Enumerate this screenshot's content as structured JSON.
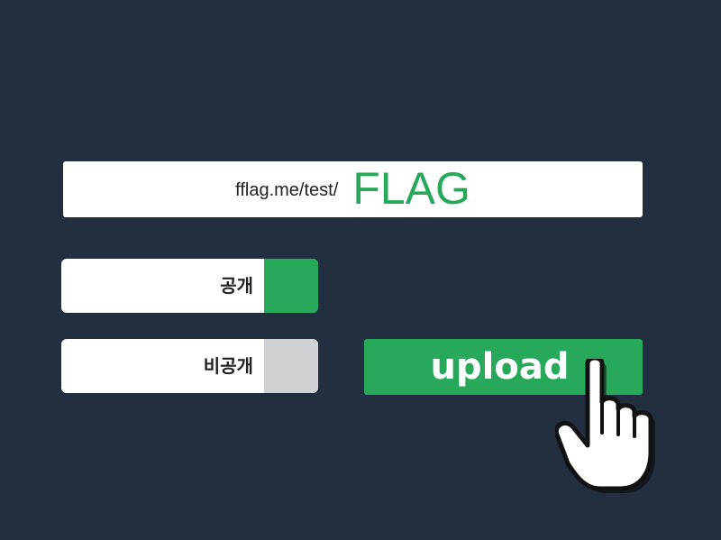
{
  "url_field": {
    "prefix": "fflag.me/test/",
    "slug": "FLAG"
  },
  "visibility": {
    "public_label": "공개",
    "private_label": "비공개",
    "selected": "public"
  },
  "upload_button": {
    "label": "upload"
  },
  "cursor": {
    "icon": "hand-pointer-icon"
  },
  "colors": {
    "background": "#222f40",
    "accent": "#27a85a",
    "inactive": "#d0d1d4"
  }
}
